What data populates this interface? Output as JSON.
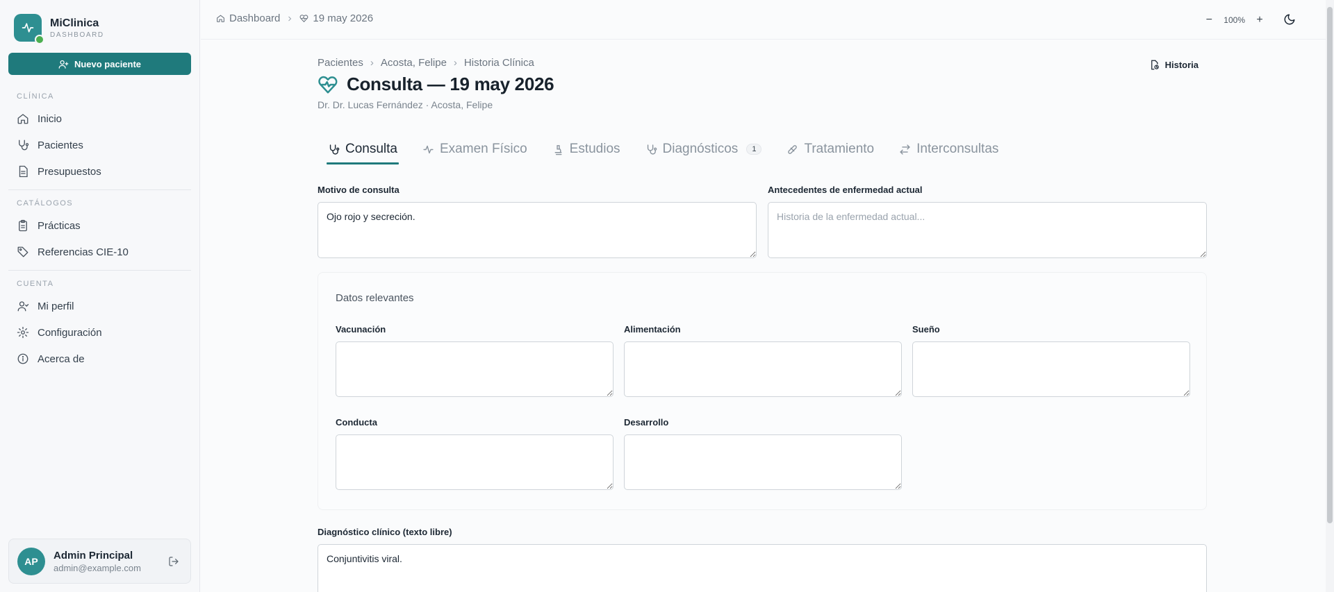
{
  "brand": {
    "name": "MiClinica",
    "subtitle": "DASHBOARD"
  },
  "sidebar": {
    "new_patient_label": "Nuevo paciente",
    "sections": [
      {
        "title": "CLÍNICA",
        "items": [
          {
            "label": "Inicio",
            "icon": "home-icon"
          },
          {
            "label": "Pacientes",
            "icon": "stethoscope-icon"
          },
          {
            "label": "Presupuestos",
            "icon": "document-icon"
          }
        ]
      },
      {
        "title": "CATÁLOGOS",
        "items": [
          {
            "label": "Prácticas",
            "icon": "clipboard-icon"
          },
          {
            "label": "Referencias CIE-10",
            "icon": "tag-icon"
          }
        ]
      },
      {
        "title": "CUENTA",
        "items": [
          {
            "label": "Mi perfil",
            "icon": "user-icon"
          },
          {
            "label": "Configuración",
            "icon": "gear-icon"
          },
          {
            "label": "Acerca de",
            "icon": "info-icon"
          }
        ]
      }
    ],
    "user": {
      "initials": "AP",
      "name": "Admin Principal",
      "email": "admin@example.com"
    }
  },
  "topbar": {
    "breadcrumb": [
      "Dashboard",
      "19 may 2026"
    ],
    "zoom": "100%",
    "zoom_minus": "−",
    "zoom_plus": "+"
  },
  "page": {
    "breadcrumb": [
      "Pacientes",
      "Acosta, Felipe",
      "Historia Clínica"
    ],
    "title": "Consulta — 19 may 2026",
    "subtitle": "Dr. Dr. Lucas Fernández · Acosta, Felipe",
    "historia_label": "Historia"
  },
  "tabs": [
    {
      "label": "Consulta",
      "icon": "stethoscope-icon",
      "active": true
    },
    {
      "label": "Examen Físico",
      "icon": "activity-icon"
    },
    {
      "label": "Estudios",
      "icon": "microscope-icon"
    },
    {
      "label": "Diagnósticos",
      "icon": "stethoscope-icon",
      "badge": "1"
    },
    {
      "label": "Tratamiento",
      "icon": "pill-icon"
    },
    {
      "label": "Interconsultas",
      "icon": "arrows-icon"
    }
  ],
  "form": {
    "motivo": {
      "label": "Motivo de consulta",
      "value": "Ojo rojo y secreción."
    },
    "antecedentes": {
      "label": "Antecedentes de enfermedad actual",
      "placeholder": "Historia de la enfermedad actual..."
    },
    "relevantes": {
      "title": "Datos relevantes",
      "vacunacion": "Vacunación",
      "alimentacion": "Alimentación",
      "sueno": "Sueño",
      "conducta": "Conducta",
      "desarrollo": "Desarrollo"
    },
    "diagnostico": {
      "label": "Diagnóstico clínico (texto libre)",
      "value": "Conjuntivitis viral."
    }
  },
  "colors": {
    "accent": "#1f7a7c",
    "brand": "#2e8f91",
    "status": "#4caf50"
  }
}
